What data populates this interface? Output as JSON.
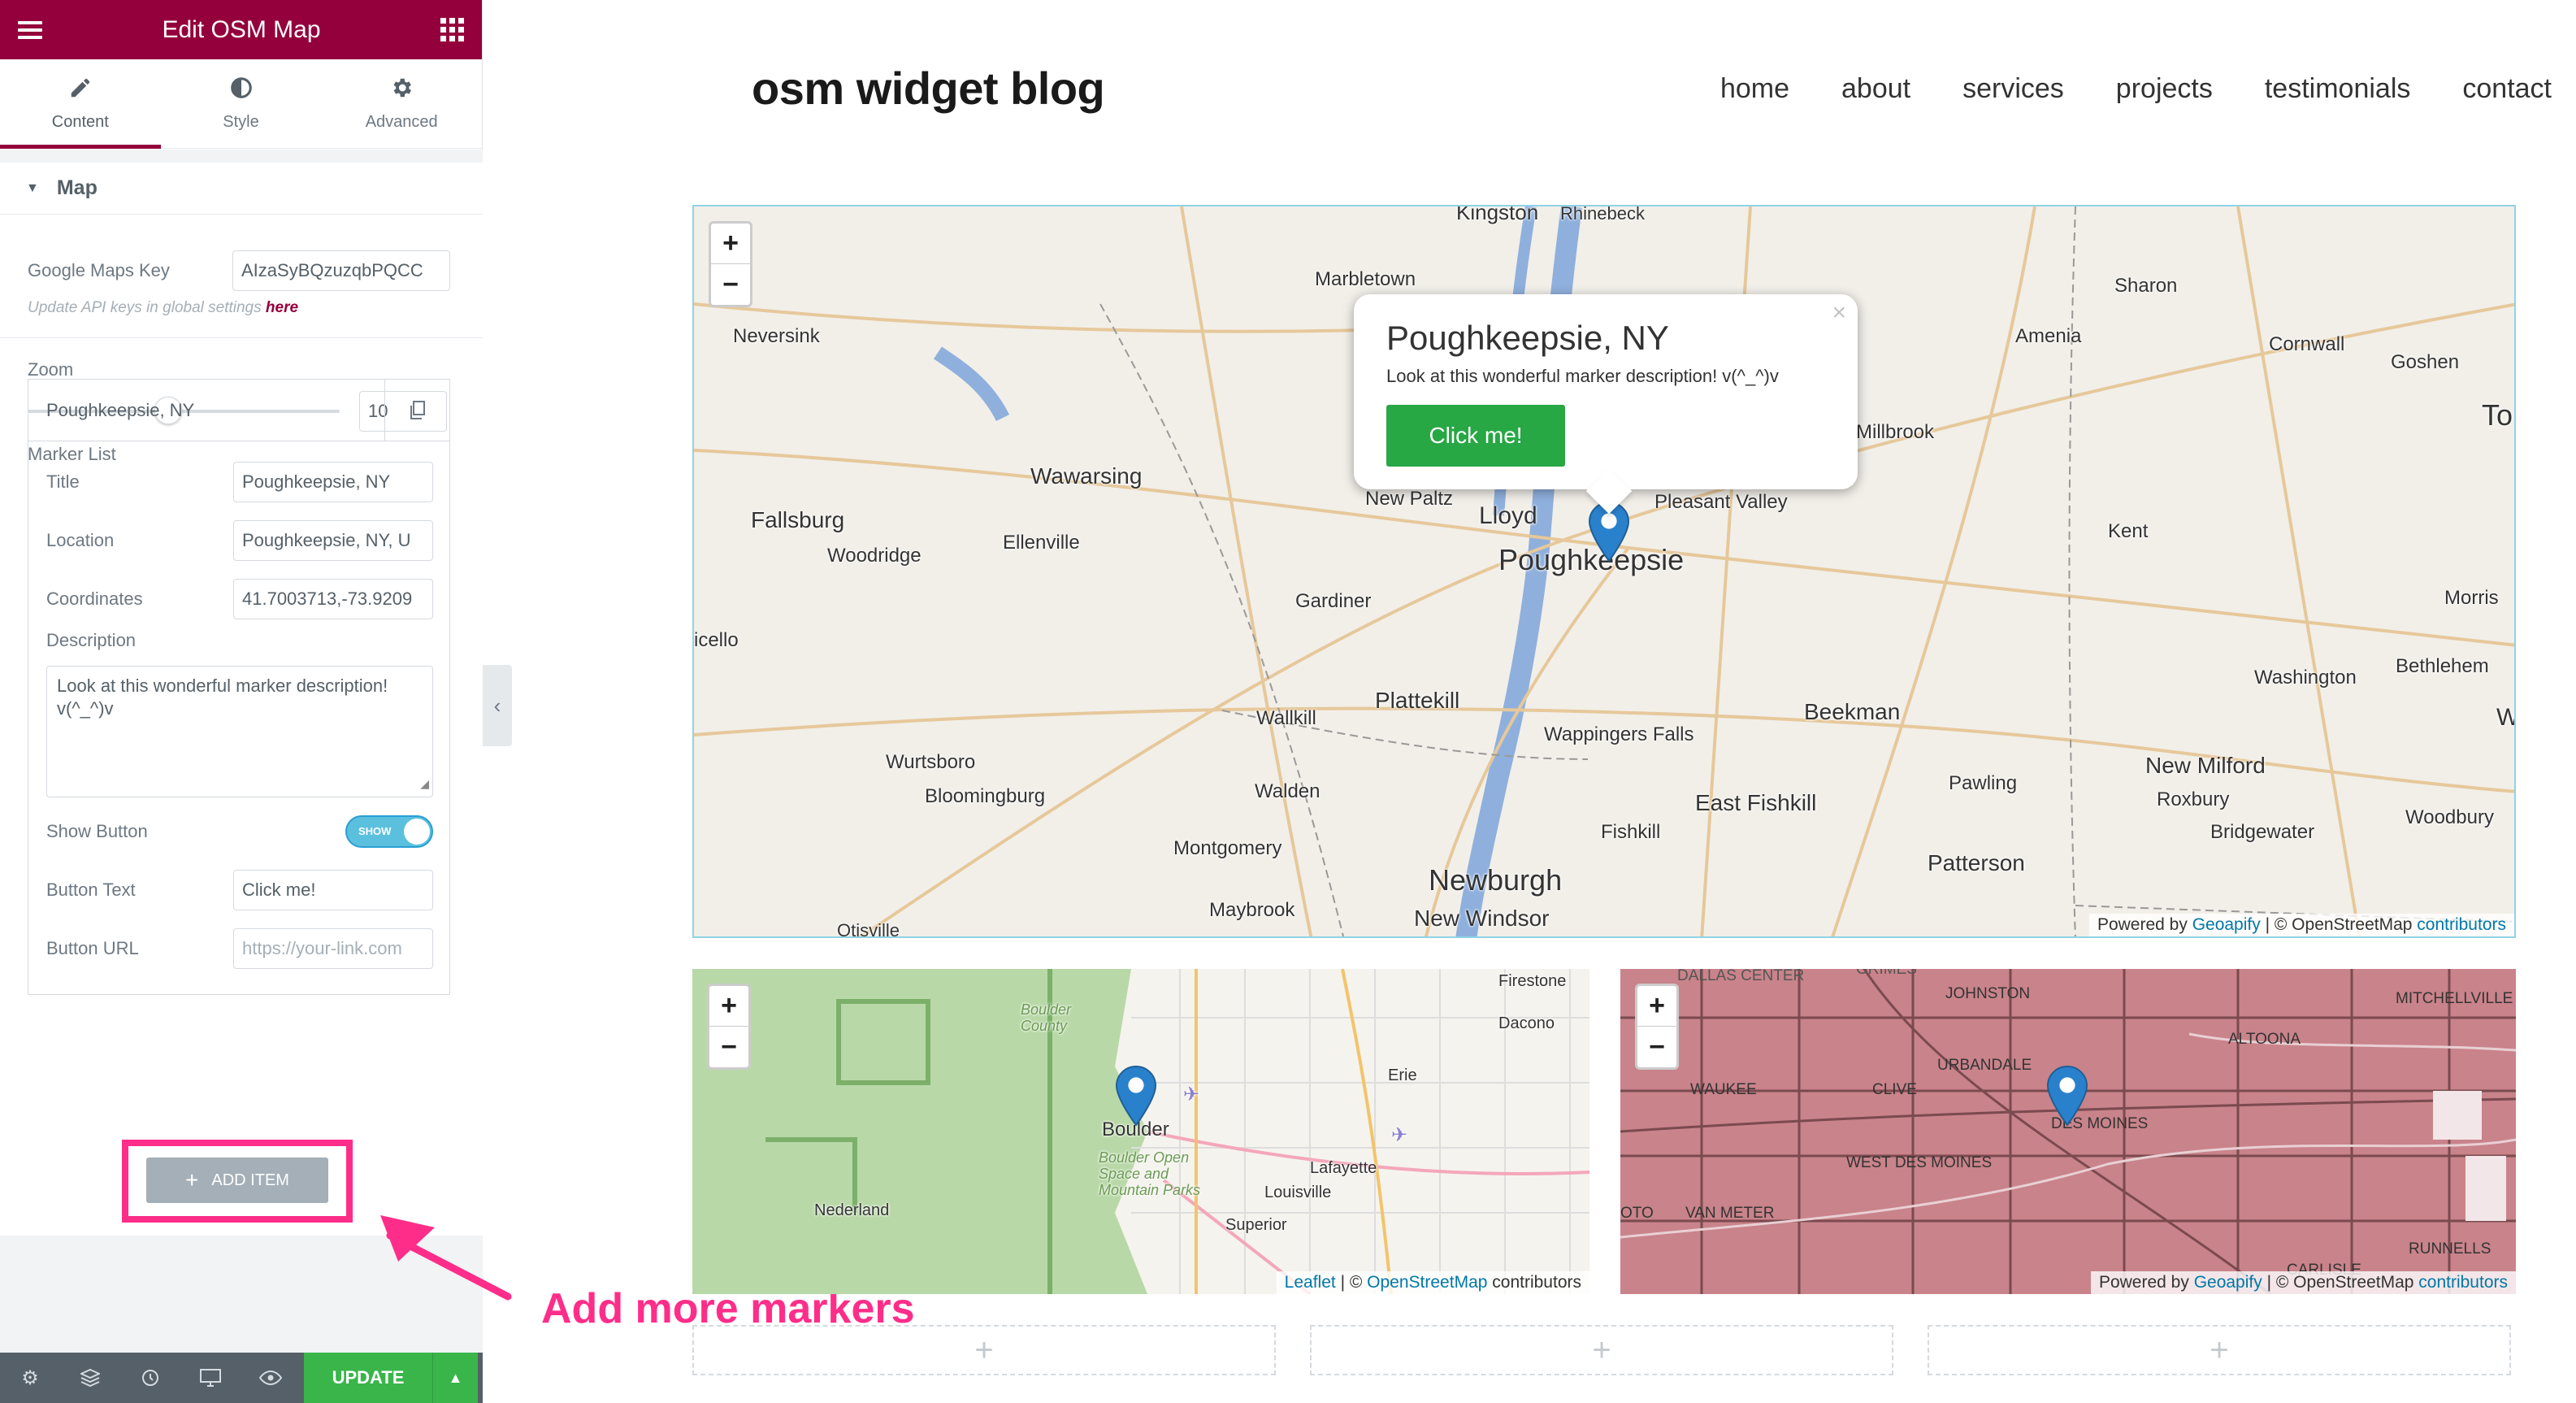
{
  "panel": {
    "title": "Edit OSM Map",
    "tabs": [
      {
        "label": "Content",
        "icon": "pencil-icon"
      },
      {
        "label": "Style",
        "icon": "half-circle-icon"
      },
      {
        "label": "Advanced",
        "icon": "gear-icon"
      }
    ],
    "section_title": "Map",
    "google_key_label": "Google Maps Key",
    "google_key_value": "AIzaSyBQzuzqbPQCC",
    "api_note": "Update API keys in global settings ",
    "api_note_link": "here",
    "zoom_label": "Zoom",
    "zoom_value": "10",
    "zoom_level_fraction": 0.45,
    "marker_list_label": "Marker List",
    "marker": {
      "header": "Poughkeepsie, NY",
      "title_label": "Title",
      "title_value": "Poughkeepsie, NY",
      "location_label": "Location",
      "location_value": "Poughkeepsie, NY, U",
      "coords_label": "Coordinates",
      "coords_value": "41.7003713,-73.9209",
      "desc_label": "Description",
      "desc_value": "Look at this wonderful marker description! v(^_^)v",
      "show_button_label": "Show Button",
      "show_toggle": "SHOW",
      "button_text_label": "Button Text",
      "button_text_value": "Click me!",
      "button_url_label": "Button URL",
      "button_url_placeholder": "https://your-link.com"
    },
    "add_item": "ADD ITEM",
    "update": "UPDATE"
  },
  "annotation": "Add more markers",
  "site": {
    "logo": "osm widget blog",
    "nav": [
      "home",
      "about",
      "services",
      "projects",
      "testimonials",
      "contact"
    ]
  },
  "map_main": {
    "popup_title": "Poughkeepsie, NY",
    "popup_desc": "Look at this wonderful marker description! v(^_^)v",
    "popup_button": "Click me!",
    "attribution_prefix": "Powered by ",
    "attribution_geo": "Geoapify",
    "attribution_mid": " | © OpenStreetMap ",
    "attribution_contrib": "contributors",
    "places": [
      "Kingston",
      "Rhinebeck",
      "Marbletown",
      "Sharon",
      "Neversink",
      "Amenia",
      "Cornwall",
      "Goshen",
      "To",
      "Millbrook",
      "Wawarsing",
      "Fallsburg",
      "Woodridge",
      "Ellenville",
      "New Paltz",
      "Lloyd",
      "Pleasant Valley",
      "Poughkeepsie",
      "Kent",
      "Morris",
      "icello",
      "Gardiner",
      "Washington",
      "Bethlehem",
      "Plattekill",
      "Wallkill",
      "Beekman",
      "Wappingers Falls",
      "W",
      "Wurtsboro",
      "Bloomingburg",
      "Walden",
      "East Fishkill",
      "Pawling",
      "New Milford",
      "Roxbury",
      "Woodbury",
      "Bridgewater",
      "Montgomery",
      "Fishkill",
      "Patterson",
      "Newburgh",
      "Maybrook",
      "New Windsor",
      "Otisville"
    ]
  },
  "map_b": {
    "places": [
      "Firestone",
      "Dacono",
      "Boulder County",
      "Erie",
      "Boulder",
      "Lafayette",
      "Louisville",
      "Nederland",
      "Boulder Open Space and Mountain Parks",
      "Superior"
    ],
    "attr_leaflet": "Leaflet",
    "attr_sep": " | © ",
    "attr_osm": "OpenStreetMap",
    "attr_rest": " contributors"
  },
  "map_c": {
    "places": [
      "DALLAS CENTER",
      "GRIMES",
      "JOHNSTON",
      "MITCHELLVILLE",
      "ALTOONA",
      "URBANDALE",
      "WAUKEE",
      "CLIVE",
      "DES MOINES",
      "WEST DES MOINES",
      "VAN METER",
      "RUNNELLS",
      "CARLISLE",
      "OTO"
    ],
    "attribution_prefix": "Powered by ",
    "attribution_geo": "Geoapify",
    "attribution_mid": " | © OpenStreetMap ",
    "attribution_contrib": "contributors"
  },
  "colors": {
    "panel_header": "#93003c",
    "annotation": "#ff2d8a",
    "update": "#39b54a",
    "marker": "#2a81cb"
  }
}
